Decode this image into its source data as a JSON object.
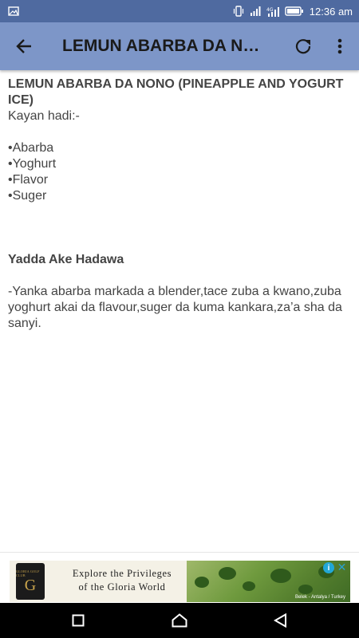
{
  "status_bar": {
    "time": "12:36 am",
    "icons": [
      "image-notification-icon",
      "vibrate-icon",
      "signal-icon",
      "signal-4g-icon",
      "battery-icon"
    ],
    "background": "#4f6aa0"
  },
  "app_bar": {
    "title": "LEMUN ABARBA DA NONO...",
    "background": "#7d96c8",
    "icons": [
      "back-arrow-icon",
      "refresh-icon",
      "more-vert-icon"
    ]
  },
  "content": {
    "title": "LEMUN ABARBA DA NONO (PINEAPPLE AND YOGURT ICE)",
    "ingredients_label": "Kayan hadi:-",
    "ingredients": [
      "•Abarba",
      "•Yoghurt",
      "•Flavor",
      "•Suger"
    ],
    "method_heading": "Yadda Ake Hadawa",
    "method_text": "-Yanka abarba markada a blender,tace zuba a kwano,zuba yoghurt akai da flavour,suger da kuma kankara,za’a sha da sanyi."
  },
  "ad": {
    "logo_small": "GLORIA GOLF CLUB",
    "logo_letter": "G",
    "text_line1": "Explore the Privileges",
    "text_line2": "of the Gloria World",
    "caption": "Belek - Antalya / Turkey",
    "info_icon": "i",
    "close_icon": "✕"
  },
  "nav_bar": {
    "icons": [
      "recents-square-icon",
      "home-icon",
      "back-triangle-icon"
    ]
  }
}
